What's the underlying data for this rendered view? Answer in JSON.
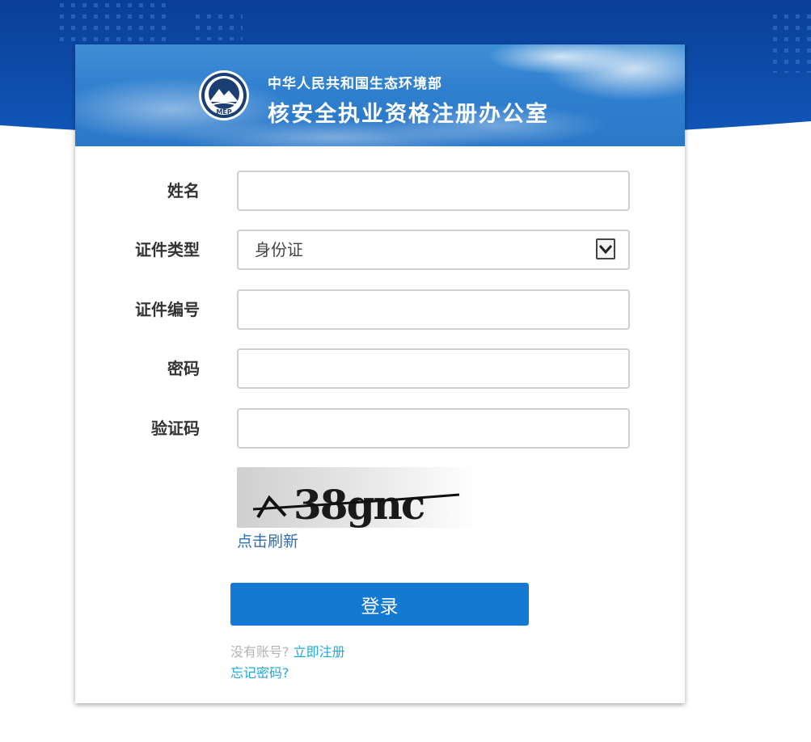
{
  "colors": {
    "primary": "#1479d2",
    "link": "#21a8d8",
    "refresh_link": "#2a6fb5",
    "label": "#333333",
    "banner": "#2f7fcf",
    "top_background": "#0c4aa6"
  },
  "header": {
    "logo_text": "MEP",
    "org_subtitle": "中华人民共和国生态环境部",
    "org_title": "核安全执业资格注册办公室"
  },
  "form": {
    "name": {
      "label": "姓名",
      "value": ""
    },
    "id_type": {
      "label": "证件类型",
      "value": "身份证",
      "icon": "chevron-down-icon"
    },
    "id_number": {
      "label": "证件编号",
      "value": ""
    },
    "password": {
      "label": "密码",
      "value": ""
    },
    "captcha": {
      "label": "验证码",
      "value": "",
      "image_text": "38gnc"
    },
    "refresh_label": "点击刷新",
    "login_label": "登录"
  },
  "footer": {
    "no_account_text": "没有账号?",
    "register_link": "立即注册",
    "forgot_password": "忘记密码?"
  }
}
